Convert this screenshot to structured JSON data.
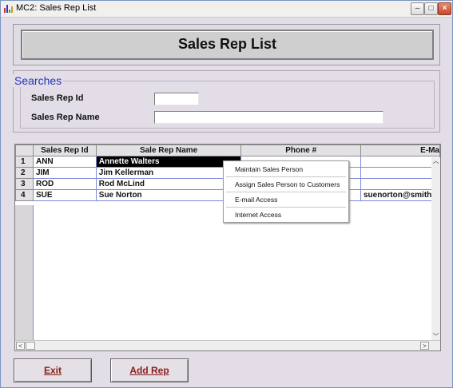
{
  "window": {
    "title": "MC2: Sales Rep List"
  },
  "header": {
    "title": "Sales Rep List"
  },
  "searches": {
    "legend": "Searches",
    "id_label": "Sales Rep Id",
    "name_label": "Sales Rep Name",
    "id_value": "",
    "name_value": ""
  },
  "table": {
    "columns": [
      "Sales Rep Id",
      "Sale Rep Name",
      "Phone #",
      "E-Ma"
    ],
    "rows": [
      {
        "num": "1",
        "id": "ANN",
        "name": "Annette Walters",
        "phone": "",
        "email": ""
      },
      {
        "num": "2",
        "id": "JIM",
        "name": "Jim Kellerman",
        "phone": "",
        "email": ""
      },
      {
        "num": "3",
        "id": "ROD",
        "name": "Rod McLind",
        "phone": "",
        "email": ""
      },
      {
        "num": "4",
        "id": "SUE",
        "name": "Sue Norton",
        "phone": "",
        "email": "suenorton@smiths"
      }
    ]
  },
  "context_menu": {
    "items": [
      "Maintain Sales Person",
      "Assign Sales Person to Customers",
      "E-mail Access",
      "Internet Access"
    ]
  },
  "buttons": {
    "exit": "Exit",
    "add": "Add Rep"
  },
  "colors": {
    "accent": "#2235b8",
    "button_text": "#8a1c1c",
    "selection": "#000000"
  }
}
